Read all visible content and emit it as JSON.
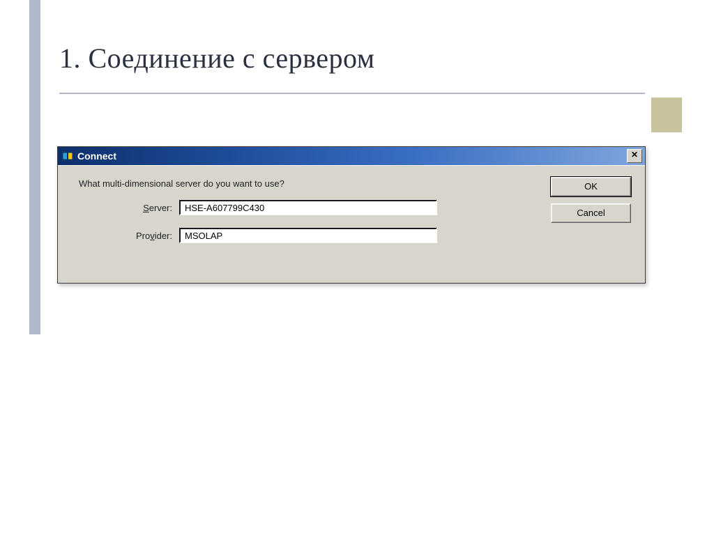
{
  "slide": {
    "title": "1. Соединение с сервером"
  },
  "dialog": {
    "title": "Connect",
    "close_glyph": "✕",
    "prompt": "What multi-dimensional server do you want to use?",
    "server": {
      "label_pre": "",
      "label_u": "S",
      "label_post": "erver:",
      "value": "HSE-A607799C430"
    },
    "provider": {
      "label_pre": "Pro",
      "label_u": "v",
      "label_post": "ider:",
      "value": "MSOLAP"
    },
    "buttons": {
      "ok": "OK",
      "cancel": "Cancel"
    }
  }
}
